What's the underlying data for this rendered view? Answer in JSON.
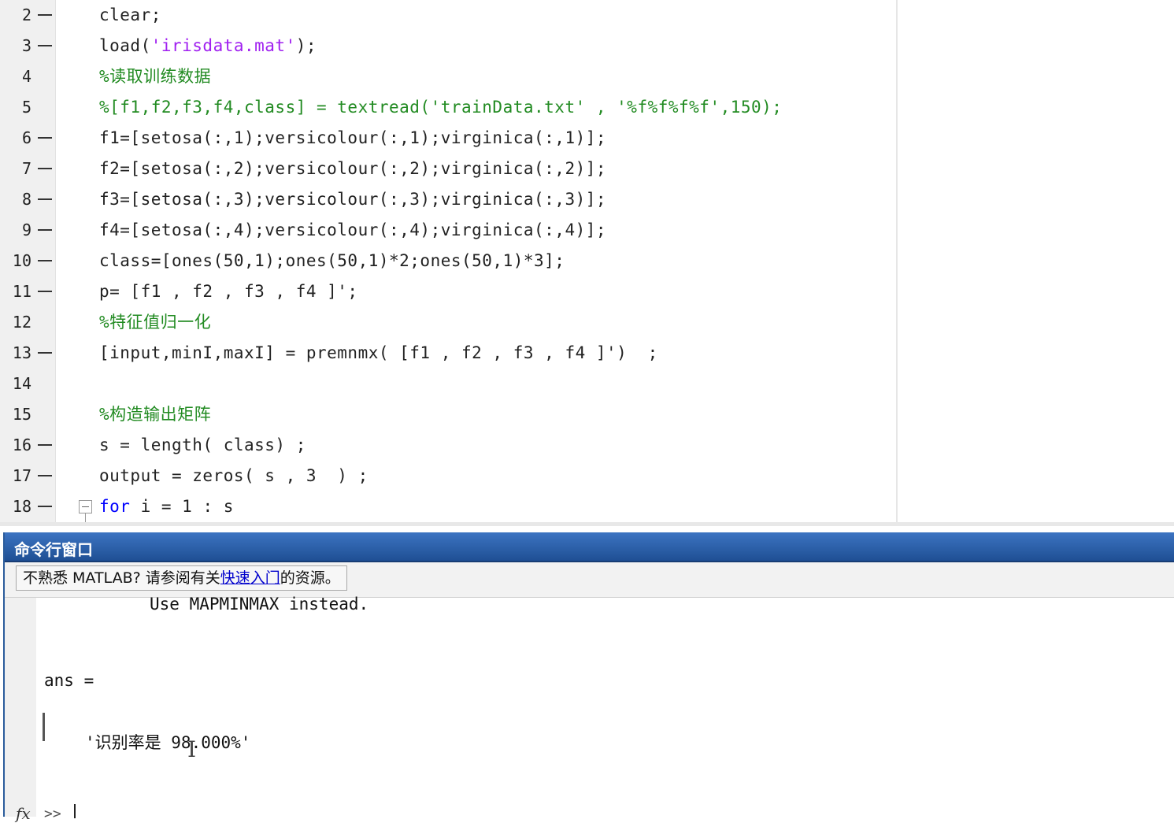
{
  "editor": {
    "lines": [
      {
        "num": "2",
        "exec": true,
        "segments": [
          {
            "t": "clear;",
            "c": "normal"
          }
        ]
      },
      {
        "num": "3",
        "exec": true,
        "segments": [
          {
            "t": "load(",
            "c": "normal"
          },
          {
            "t": "'irisdata.mat'",
            "c": "str"
          },
          {
            "t": ");",
            "c": "normal"
          }
        ]
      },
      {
        "num": "4",
        "exec": false,
        "segments": [
          {
            "t": "%读取训练数据",
            "c": "comment"
          }
        ]
      },
      {
        "num": "5",
        "exec": false,
        "segments": [
          {
            "t": "%[f1,f2,f3,f4,class] = textread('trainData.txt' , '%f%f%f%f',150);",
            "c": "comment"
          }
        ]
      },
      {
        "num": "6",
        "exec": true,
        "segments": [
          {
            "t": "f1=[setosa(:,1);versicolour(:,1);virginica(:,1)];",
            "c": "normal"
          }
        ]
      },
      {
        "num": "7",
        "exec": true,
        "segments": [
          {
            "t": "f2=[setosa(:,2);versicolour(:,2);virginica(:,2)];",
            "c": "normal"
          }
        ]
      },
      {
        "num": "8",
        "exec": true,
        "segments": [
          {
            "t": "f3=[setosa(:,3);versicolour(:,3);virginica(:,3)];",
            "c": "normal"
          }
        ]
      },
      {
        "num": "9",
        "exec": true,
        "segments": [
          {
            "t": "f4=[setosa(:,4);versicolour(:,4);virginica(:,4)];",
            "c": "normal"
          }
        ]
      },
      {
        "num": "10",
        "exec": true,
        "segments": [
          {
            "t": "class=[ones(50,1);ones(50,1)*2;ones(50,1)*3];",
            "c": "normal"
          }
        ]
      },
      {
        "num": "11",
        "exec": true,
        "segments": [
          {
            "t": "p= [f1 , f2 , f3 , f4 ]';",
            "c": "normal"
          }
        ]
      },
      {
        "num": "12",
        "exec": false,
        "segments": [
          {
            "t": "%特征值归一化",
            "c": "comment"
          }
        ]
      },
      {
        "num": "13",
        "exec": true,
        "segments": [
          {
            "t": "[input,minI,maxI] = premnmx( [f1 , f2 , f3 , f4 ]')  ;",
            "c": "normal"
          }
        ]
      },
      {
        "num": "14",
        "exec": false,
        "segments": []
      },
      {
        "num": "15",
        "exec": false,
        "segments": [
          {
            "t": "%构造输出矩阵",
            "c": "comment"
          }
        ]
      },
      {
        "num": "16",
        "exec": true,
        "segments": [
          {
            "t": "s = length( class) ;",
            "c": "normal"
          }
        ]
      },
      {
        "num": "17",
        "exec": true,
        "segments": [
          {
            "t": "output = zeros( s , 3  ) ;",
            "c": "normal"
          }
        ]
      },
      {
        "num": "18",
        "exec": true,
        "segments": [
          {
            "t": "for",
            "c": "kw"
          },
          {
            "t": " i = 1 : s",
            "c": "normal"
          }
        ],
        "fold": true
      }
    ]
  },
  "command_window": {
    "title": "命令行窗口",
    "info": {
      "prefix": "不熟悉 MATLAB? 请参阅有关",
      "link": "快速入门",
      "suffix": "的资源。"
    },
    "output": {
      "warning_tail": "Use MAPMINMAX instead.",
      "ans_label": "ans =",
      "result": "'识别率是 98.000%'"
    },
    "prompt_fx": "fx",
    "prompt": ">>"
  },
  "colors": {
    "comment": "#228b22",
    "string": "#a020f0",
    "keyword": "#0000ff",
    "titlebar": "#2b5c9c"
  }
}
